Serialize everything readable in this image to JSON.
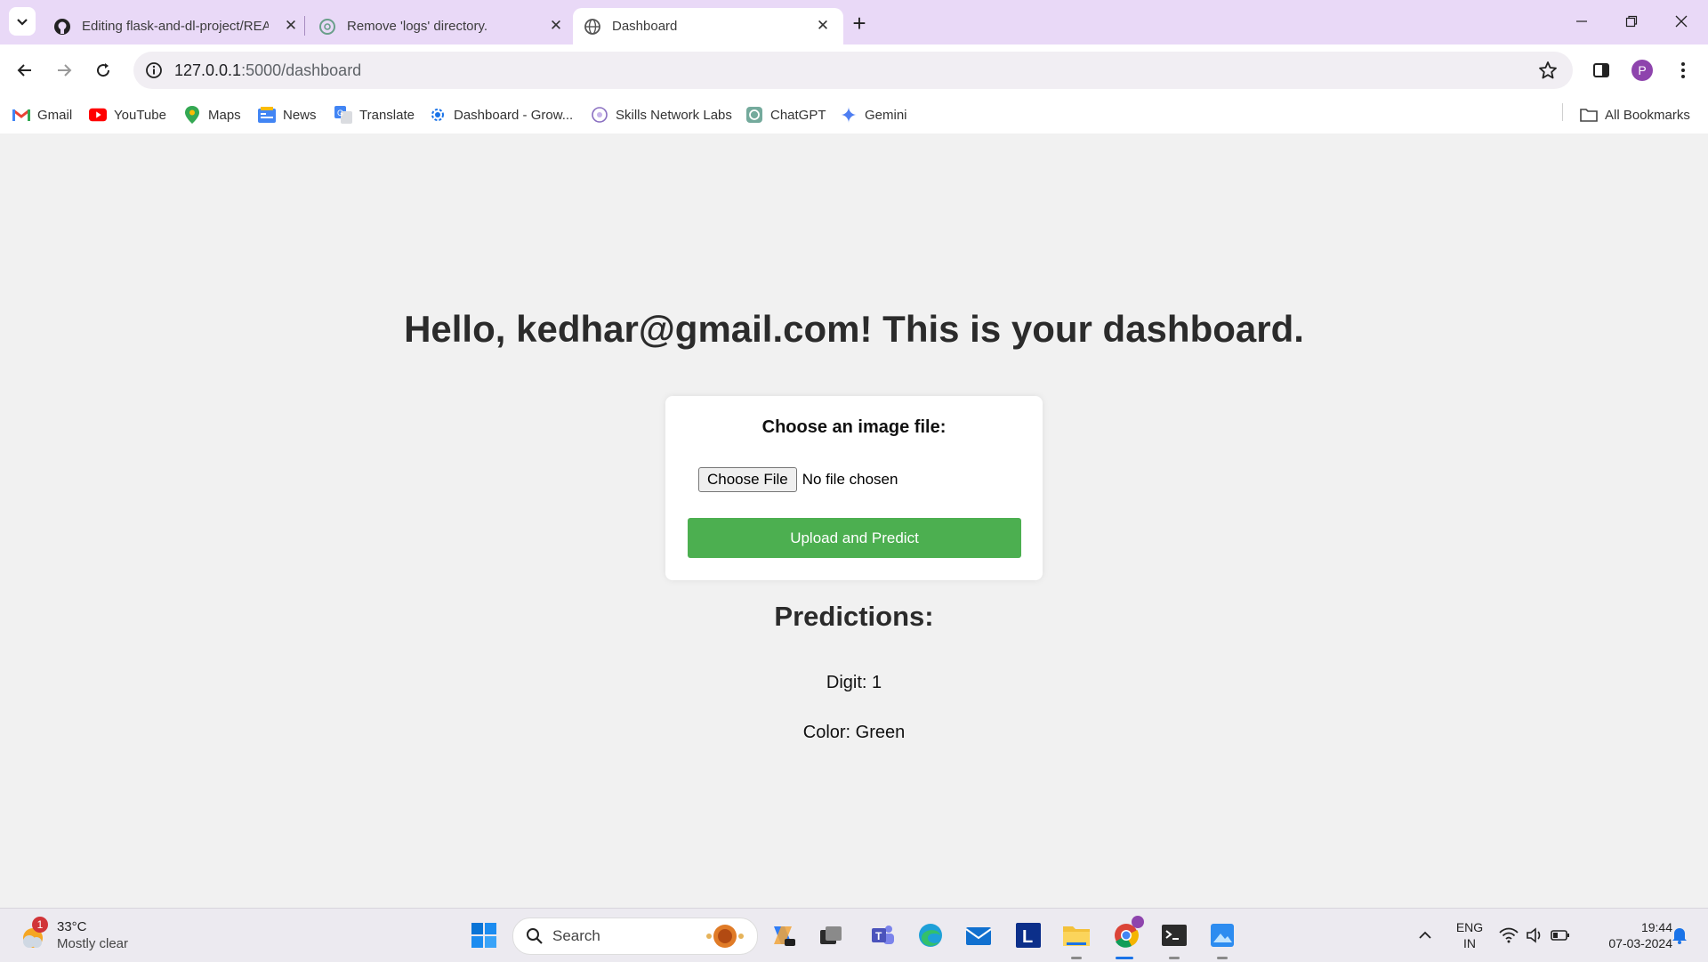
{
  "browser": {
    "tabs": [
      {
        "title": "Editing flask-and-dl-project/README.md",
        "icon": "github-icon",
        "active": false
      },
      {
        "title": "Remove 'logs' directory.",
        "icon": "chatgpt-icon",
        "active": false
      },
      {
        "title": "Dashboard",
        "icon": "globe-icon",
        "active": true
      }
    ],
    "url_host": "127.0.0.1",
    "url_path": ":5000/dashboard",
    "profile_initial": "P"
  },
  "bookmarks": [
    {
      "label": "Gmail",
      "icon": "gmail-icon"
    },
    {
      "label": "YouTube",
      "icon": "youtube-icon"
    },
    {
      "label": "Maps",
      "icon": "maps-icon"
    },
    {
      "label": "News",
      "icon": "news-icon"
    },
    {
      "label": "Translate",
      "icon": "translate-icon"
    },
    {
      "label": "Dashboard - Grow...",
      "icon": "gear-icon"
    },
    {
      "label": "Skills Network Labs",
      "icon": "skills-network-icon"
    },
    {
      "label": "ChatGPT",
      "icon": "chatgpt-icon"
    },
    {
      "label": "Gemini",
      "icon": "gemini-icon"
    }
  ],
  "all_bookmarks_label": "All Bookmarks",
  "page": {
    "heading": "Hello, kedhar@gmail.com! This is your dashboard.",
    "upload_label": "Choose an image file:",
    "choose_file_label": "Choose File",
    "file_status": "No file chosen",
    "upload_button": "Upload and Predict",
    "predictions_title": "Predictions:",
    "predictions": [
      "Digit: 1",
      "Color: Green"
    ],
    "accent_color": "#4caf50"
  },
  "taskbar": {
    "weather_temp": "33°C",
    "weather_condition": "Mostly clear",
    "weather_badge": "1",
    "search_placeholder": "Search",
    "language": "ENG",
    "region": "IN",
    "time": "19:44",
    "date": "07-03-2024"
  }
}
